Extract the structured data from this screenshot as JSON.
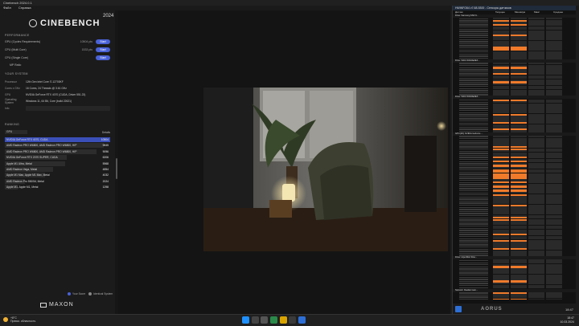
{
  "window": {
    "title": "Cinebench 2024.0.1",
    "menu": [
      "Файл",
      "Справка"
    ]
  },
  "app": {
    "logo": "CINEBENCH",
    "year": "2024",
    "performance_title": "PERFORMANCE",
    "benchmarks": [
      {
        "label": "GPU (Cycles Requirements)",
        "value": "10504 pts",
        "button": "Start"
      },
      {
        "label": "CPU (Multi Core)",
        "value": "1533 pts",
        "button": "Start"
      },
      {
        "label": "CPU (Single Core)",
        "value": "",
        "button": "Start"
      },
      {
        "label": "MP Ratio",
        "value": "",
        "button": ""
      }
    ],
    "system_title": "YOUR SYSTEM",
    "system": [
      {
        "key": "Processor",
        "value": "12th Gen Intel Core i7-12700KF"
      },
      {
        "key": "Cores x GHz",
        "value": "16 Cores, 24 Threads @ 3.61 GHz"
      },
      {
        "key": "GPU",
        "value": "NVIDIA GeForce RTX 4070 (CUDA, Driver 551.23)"
      },
      {
        "key": "Operating System",
        "value": "Windows 11, 64 Bit, Core (build 22621)"
      },
      {
        "key": "Info",
        "value": ""
      }
    ],
    "ranking_title": "RANKING",
    "ranking_select": "GPU",
    "ranking_details": "Details",
    "ranking": [
      {
        "name": "NVIDIA GeForce RTX 4070, CUDA",
        "score": "10504",
        "pct": 1.0,
        "highlight": true
      },
      {
        "name": "AMD Radeon PRO W6800, AMD Radeon PRO W6800, HIP",
        "score": "9845",
        "pct": 0.94,
        "highlight": false
      },
      {
        "name": "AMD Radeon PRO W6800, AMD Radeon PRO W6800, HIP",
        "score": "9096",
        "pct": 0.87,
        "highlight": false
      },
      {
        "name": "NVIDIA GeForce RTX 2070 SUPER, CUDA",
        "score": "6206",
        "pct": 0.59,
        "highlight": false
      },
      {
        "name": "Apple M1 Ultra, Metal",
        "score": "5968",
        "pct": 0.57,
        "highlight": false
      },
      {
        "name": "AMD Radeon Vega, Metal",
        "score": "4854",
        "pct": 0.46,
        "highlight": false
      },
      {
        "name": "Apple M1 Max, Apple M1 Max, Metal",
        "score": "4032",
        "pct": 0.38,
        "highlight": false
      },
      {
        "name": "AMD Radeon Pro 5500M, Metal",
        "score": "2024",
        "pct": 0.19,
        "highlight": false
      },
      {
        "name": "Apple M1, Apple M1, Metal",
        "score": "1298",
        "pct": 0.12,
        "highlight": false
      }
    ],
    "legend": {
      "your_score": "Your Score",
      "identical": "Identical System"
    },
    "footer_brand": "MAXON"
  },
  "hwinfo": {
    "title": "HWiNFO64 v7.68-5300 - Сенсоры датчиков",
    "columns": [
      "Датчик",
      "Текущее",
      "Минимум",
      "Макс",
      "Среднее"
    ],
    "groups": [
      "Drive: Samsung SSD 9...",
      "Drive: WDC WD10EZEX...",
      "Drive: WDC WD10EZEX...",
      "GPU [#0]: NVIDIA GeForce ...",
      "Drive: HiperDisk Silve...",
      "Network: Realtek Gam..."
    ],
    "brand": "AORUS",
    "time": "18:47"
  },
  "taskbar": {
    "weather_temp": "+8°C",
    "weather_text": "Преим. облачность",
    "time": "18:47",
    "date": "10.03.2024"
  },
  "colors": {
    "accent": "#4a62d6",
    "orange": "#f07a2a"
  }
}
